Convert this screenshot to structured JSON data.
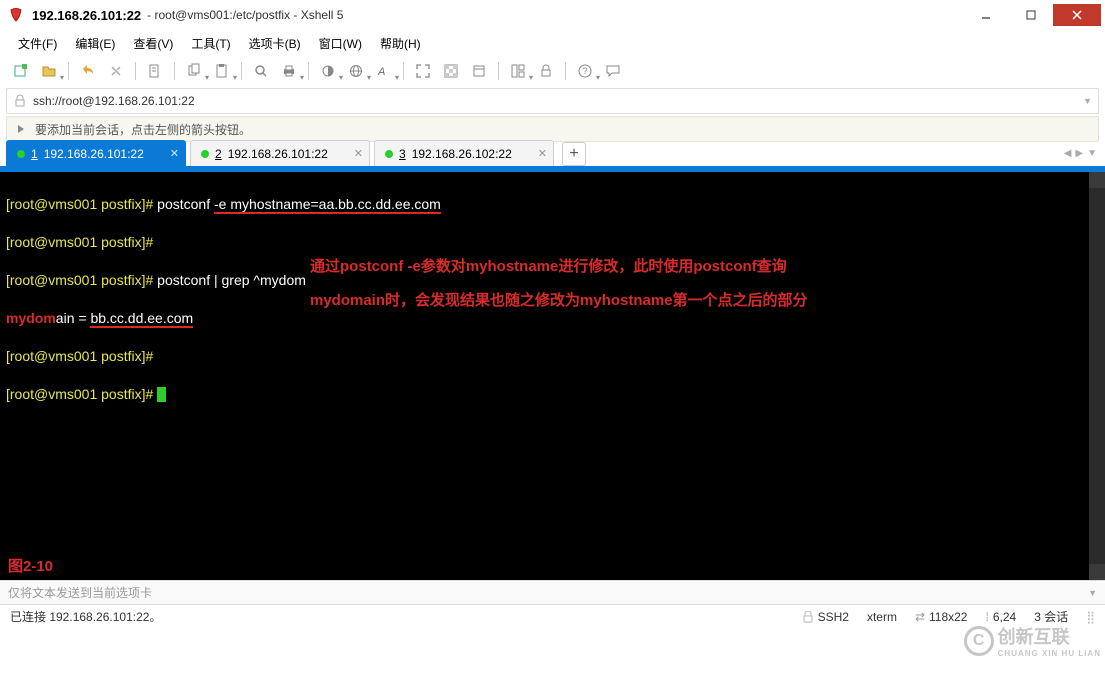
{
  "titlebar": {
    "ip": "192.168.26.101:22",
    "subtitle": "root@vms001:/etc/postfix - Xshell 5"
  },
  "menu": {
    "file": "文件(F)",
    "edit": "编辑(E)",
    "view": "查看(V)",
    "tools": "工具(T)",
    "tabs_opt": "选项卡(B)",
    "window": "窗口(W)",
    "help": "帮助(H)"
  },
  "address": {
    "url": "ssh://root@192.168.26.101:22"
  },
  "infobar": {
    "text": "要添加当前会话，点击左侧的箭头按钮。"
  },
  "tabs": [
    {
      "num": "1",
      "label": "192.168.26.101:22",
      "active": true
    },
    {
      "num": "2",
      "label": "192.168.26.101:22",
      "active": false
    },
    {
      "num": "3",
      "label": "192.168.26.102:22",
      "active": false
    }
  ],
  "terminal": {
    "lines": [
      {
        "prompt": "[root@vms001 postfix]# ",
        "cmd_pre": "postconf ",
        "cmd_hi": "-e myhostname=aa.bb.cc.dd.ee.com"
      },
      {
        "prompt": "[root@vms001 postfix]# ",
        "cmd_pre": "",
        "cmd_hi": ""
      },
      {
        "prompt": "[root@vms001 postfix]# ",
        "cmd_pre": "postconf | grep ^mydom",
        "cmd_hi": ""
      },
      {
        "output_key": "mydom",
        "output_rest": "ain = ",
        "output_hi": "bb.cc.dd.ee.com"
      },
      {
        "prompt": "[root@vms001 postfix]# ",
        "cmd_pre": "",
        "cmd_hi": ""
      },
      {
        "prompt": "[root@vms001 postfix]# ",
        "cursor": true
      }
    ],
    "annotation_line1": "通过postconf -e参数对myhostname进行修改，此时使用postconf查询",
    "annotation_line2": "mydomain时，会发现结果也随之修改为myhostname第一个点之后的部分",
    "figure_label": "图2-10"
  },
  "sendbar": {
    "placeholder": "仅将文本发送到当前选项卡"
  },
  "statusbar": {
    "conn": "已连接 192.168.26.101:22。",
    "ssh": "SSH2",
    "term": "xterm",
    "size": "118x22",
    "pos": "6,24",
    "sessions": "3 会话"
  },
  "watermark": {
    "main": "创新互联",
    "sub": "CHUANG XIN HU LIAN"
  }
}
